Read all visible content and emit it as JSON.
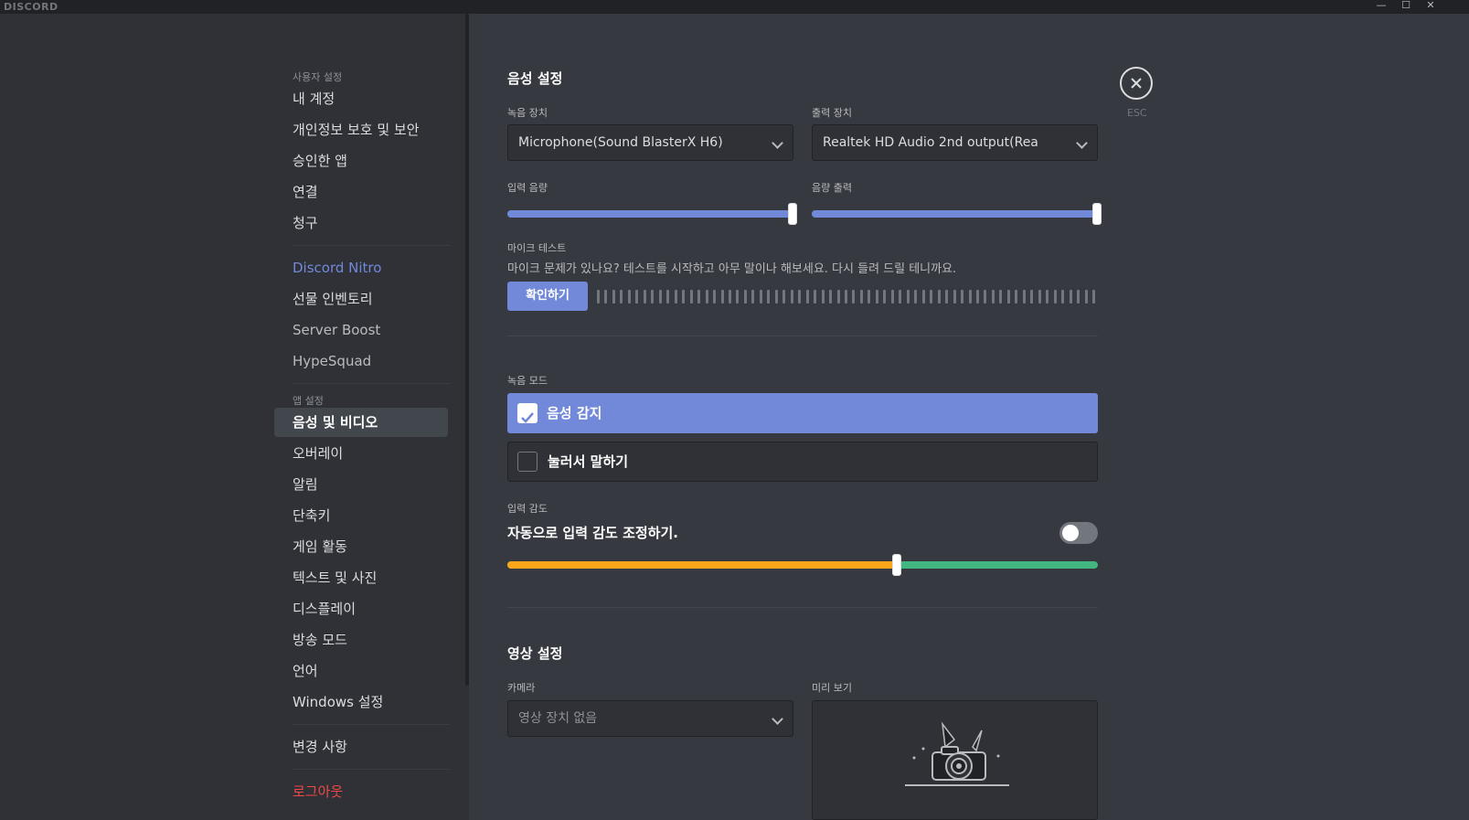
{
  "app": {
    "brand": "DISCORD"
  },
  "window": {
    "minimize": "—",
    "maximize": "☐",
    "close": "✕"
  },
  "sidebar": {
    "user_settings_header": "사용자 설정",
    "user_items": [
      "내 계정",
      "개인정보 보호 및 보안",
      "승인한 앱",
      "연결",
      "청구"
    ],
    "nitro_items": [
      "Discord Nitro",
      "선물 인벤토리",
      "Server Boost",
      "HypeSquad"
    ],
    "app_settings_header": "앱 설정",
    "app_items": [
      "음성 및 비디오",
      "오버레이",
      "알림",
      "단축키",
      "게임 활동",
      "텍스트 및 사진",
      "디스플레이",
      "방송 모드",
      "언어",
      "Windows 설정"
    ],
    "changelog": "변경 사항",
    "logout": "로그아웃"
  },
  "voice": {
    "title": "음성 설정",
    "input_device_label": "녹음 장치",
    "input_device_value": "Microphone(Sound BlasterX H6)",
    "output_device_label": "출력 장치",
    "output_device_value": "Realtek HD Audio 2nd output(Rea",
    "input_volume_label": "입력 음량",
    "input_volume": 1.0,
    "output_volume_label": "음량 출력",
    "output_volume": 1.0,
    "mic_test_label": "마이크 테스트",
    "mic_test_desc": "마이크 문제가 있나요? 테스트를 시작하고 아무 말이나 해보세요. 다시 들려 드릴 테니까요.",
    "mic_test_button": "확인하기",
    "input_mode_label": "녹음 모드",
    "mode_voice_activity": "음성 감지",
    "mode_push_to_talk": "눌러서 말하기",
    "sensitivity_label": "입력 감도",
    "auto_sensitivity_text": "자동으로 입력 감도 조정하기.",
    "auto_sensitivity_enabled": false,
    "sensitivity_level": 0.66
  },
  "video": {
    "title": "영상 설정",
    "camera_label": "카메라",
    "camera_value": "영상 장치 없음",
    "preview_label": "미리 보기"
  },
  "close": {
    "label": "ESC"
  },
  "colors": {
    "accent": "#7289da",
    "danger": "#f04747",
    "sensitivity_low": "#faa61a",
    "sensitivity_high": "#43b581"
  }
}
